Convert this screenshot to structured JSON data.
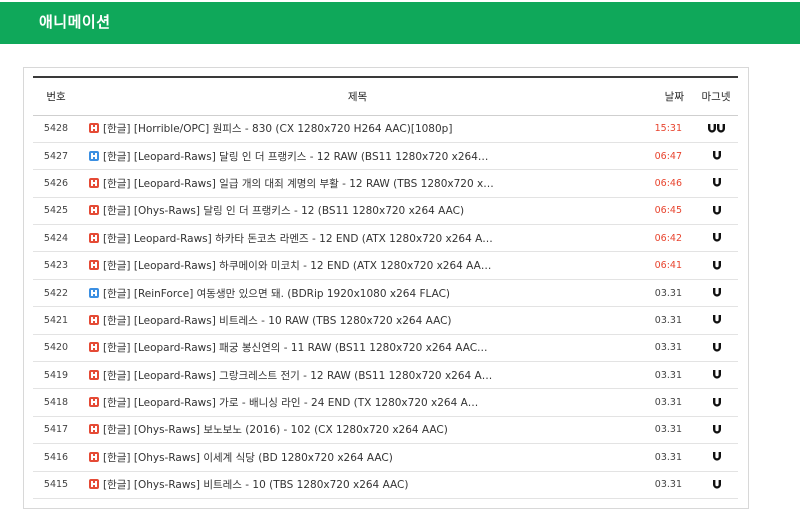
{
  "header": {
    "title": "애니메이션"
  },
  "colors": {
    "header_bg": "#0fa85a",
    "recent_date": "#e8442e",
    "flag_red": "#e54a35",
    "flag_blue": "#3b8fe2"
  },
  "table": {
    "columns": {
      "no": "번호",
      "title": "제목",
      "date": "날짜",
      "magnet": "마그넷"
    },
    "rows": [
      {
        "no": "5428",
        "flag": "red",
        "title": "[한글] [Horrible/OPC] 원피스 - 830 (CX 1280x720 H264 AAC)[1080p]",
        "date": "15:31",
        "recent": true,
        "magnets": 2
      },
      {
        "no": "5427",
        "flag": "blue",
        "title": "[한글] [Leopard-Raws] 달링 인 더 프랭키스 - 12 RAW (BS11 1280x720 x264…",
        "date": "06:47",
        "recent": true,
        "magnets": 1
      },
      {
        "no": "5426",
        "flag": "red",
        "title": "[한글] [Leopard-Raws] 일급 개의 대죄 계명의 부활 - 12 RAW (TBS 1280x720 x…",
        "date": "06:46",
        "recent": true,
        "magnets": 1
      },
      {
        "no": "5425",
        "flag": "red",
        "title": "[한글] [Ohys-Raws] 달링 인 더 프랭키스 - 12 (BS11 1280x720 x264 AAC)",
        "date": "06:45",
        "recent": true,
        "magnets": 1
      },
      {
        "no": "5424",
        "flag": "red",
        "title": "[한글] Leopard-Raws] 하카타 돈코츠 라멘즈 - 12 END (ATX 1280x720 x264 A…",
        "date": "06:42",
        "recent": true,
        "magnets": 1
      },
      {
        "no": "5423",
        "flag": "red",
        "title": "[한글] [Leopard-Raws] 하쿠메이와 미코치 - 12 END (ATX 1280x720 x264 AA…",
        "date": "06:41",
        "recent": true,
        "magnets": 1
      },
      {
        "no": "5422",
        "flag": "blue",
        "title": "[한글] [ReinForce] 여동생만 있으면 돼. (BDRip 1920x1080 x264 FLAC)",
        "date": "03.31",
        "recent": false,
        "magnets": 1
      },
      {
        "no": "5421",
        "flag": "red",
        "title": "[한글] [Leopard-Raws] 비트레스 - 10 RAW (TBS 1280x720 x264 AAC)",
        "date": "03.31",
        "recent": false,
        "magnets": 1
      },
      {
        "no": "5420",
        "flag": "red",
        "title": "[한글] [Leopard-Raws] 패궁 봉신연의 - 11 RAW (BS11 1280x720 x264 AAC…",
        "date": "03.31",
        "recent": false,
        "magnets": 1
      },
      {
        "no": "5419",
        "flag": "red",
        "title": "[한글] [Leopard-Raws] 그랑크레스트 전기 - 12 RAW (BS11 1280x720 x264 A…",
        "date": "03.31",
        "recent": false,
        "magnets": 1
      },
      {
        "no": "5418",
        "flag": "red",
        "title": "[한글] [Leopard-Raws] 가로 - 배니싱 라인 - 24 END (TX 1280x720 x264 A…",
        "date": "03.31",
        "recent": false,
        "magnets": 1
      },
      {
        "no": "5417",
        "flag": "red",
        "title": "[한글] [Ohys-Raws] 보노보노 (2016) - 102 (CX 1280x720 x264 AAC)",
        "date": "03.31",
        "recent": false,
        "magnets": 1
      },
      {
        "no": "5416",
        "flag": "red",
        "title": "[한글] [Ohys-Raws] 이세계 식당 (BD 1280x720 x264 AAC)",
        "date": "03.31",
        "recent": false,
        "magnets": 1
      },
      {
        "no": "5415",
        "flag": "red",
        "title": "[한글] [Ohys-Raws] 비트레스 - 10 (TBS 1280x720 x264 AAC)",
        "date": "03.31",
        "recent": false,
        "magnets": 1
      }
    ]
  }
}
